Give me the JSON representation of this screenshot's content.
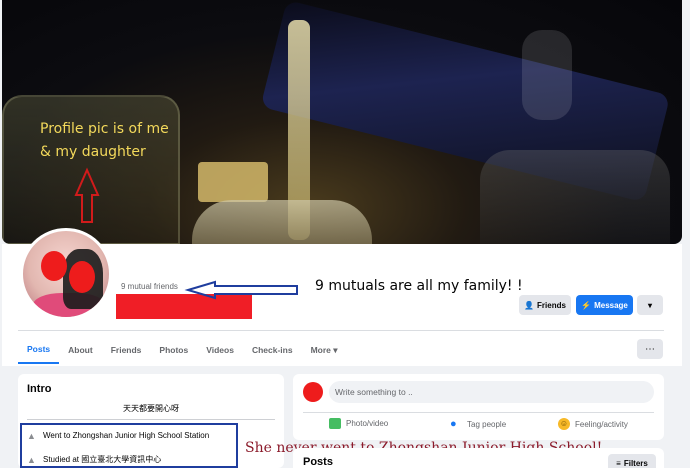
{
  "annotations": {
    "profile_pic_line1": "Profile pic is of me",
    "profile_pic_line2": "& my daughter",
    "family_note": "9 mutuals are all my family! !",
    "school_note": "She never went to Zhongshan Junior High School!",
    "colors": {
      "yellow": "#f3d95b",
      "red": "#f01e26",
      "blue": "#1f3d9e",
      "maroon": "#8b1a2a"
    }
  },
  "profile": {
    "mutual_friends": "9 mutual friends"
  },
  "actions": {
    "friends": "Friends",
    "message": "Message",
    "more_icon": "chevron-down-icon"
  },
  "tabs": [
    {
      "label": "Posts",
      "active": true
    },
    {
      "label": "About"
    },
    {
      "label": "Friends"
    },
    {
      "label": "Photos"
    },
    {
      "label": "Videos"
    },
    {
      "label": "Check-ins"
    },
    {
      "label": "More"
    }
  ],
  "intro": {
    "title": "Intro",
    "bio": "天天都要開心呀",
    "items": [
      {
        "icon": "graduation-cap-icon",
        "text": "Went to Zhongshan Junior High School Station"
      },
      {
        "icon": "graduation-cap-icon",
        "text": "Studied at 國立臺北大學資訊中心"
      }
    ]
  },
  "composer": {
    "placeholder": "Write something to ..",
    "actions": [
      {
        "icon": "photo-icon",
        "label": "Photo/video"
      },
      {
        "icon": "tag-people-icon",
        "label": "Tag people"
      },
      {
        "icon": "feeling-icon",
        "label": "Feeling/activity"
      }
    ]
  },
  "posts": {
    "title": "Posts",
    "filters": "Filters"
  },
  "brand": {
    "accent": "#1877f2"
  }
}
